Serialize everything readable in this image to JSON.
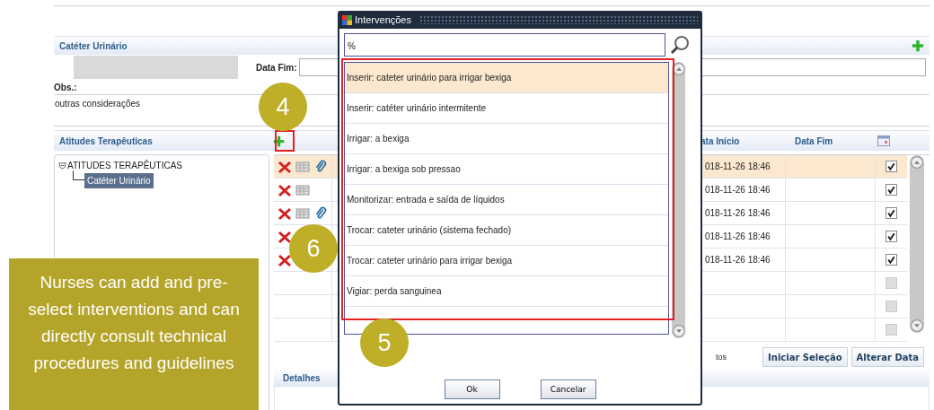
{
  "catheter": {
    "title": "Catéter Urinário",
    "date_end_label": "Data Fim:",
    "obs_label": "Obs.:",
    "obs_value": "outras considerações"
  },
  "therapeutic": {
    "title": "Atitudes Terapêuticas",
    "tree": [
      {
        "label": "ATITUDES TERAPÊUTICAS",
        "expanded": true,
        "children": [
          {
            "label": "Catéter Urinário",
            "selected": true
          }
        ]
      }
    ],
    "columns": [
      "ata Início",
      "Data Fim"
    ],
    "rows": [
      {
        "kind": "entry",
        "selected": true,
        "grid": true,
        "attachment": true,
        "start": "018-11-26 18:46",
        "checked": true
      },
      {
        "kind": "entry",
        "selected": false,
        "grid": true,
        "attachment": false,
        "start": "018-11-26 18:46",
        "checked": true
      },
      {
        "kind": "entry",
        "selected": false,
        "grid": true,
        "attachment": true,
        "start": "018-11-26 18:46",
        "checked": true
      },
      {
        "kind": "entry",
        "selected": false,
        "grid": false,
        "attachment": false,
        "start": "018-11-26 18:46",
        "checked": true
      },
      {
        "kind": "entry",
        "selected": false,
        "grid": false,
        "attachment": false,
        "start": "018-11-26 18:46",
        "checked": true
      },
      {
        "kind": "empty",
        "selected": false,
        "checked": false
      },
      {
        "kind": "empty",
        "selected": false,
        "checked": false
      },
      {
        "kind": "empty",
        "selected": false,
        "checked": false
      }
    ],
    "footer_text": "tos",
    "buttons": [
      "Iniciar Seleção",
      "Alterar Data"
    ],
    "details_title": "Detalhes"
  },
  "dialog": {
    "title": "Intervenções",
    "search_value": "%",
    "items": [
      {
        "label": "Inserir: cateter urinário para irrigar bexiga",
        "selected": true
      },
      {
        "label": "Inserir: catéter urinário intermitente",
        "selected": false
      },
      {
        "label": "Irrigar: a bexiga",
        "selected": false
      },
      {
        "label": "Irrigar: a bexiga sob pressao",
        "selected": false
      },
      {
        "label": "Monitorizar: entrada e saída de líquidos",
        "selected": false
      },
      {
        "label": "Trocar: cateter urinário (sistema fechado)",
        "selected": false
      },
      {
        "label": "Trocar: cateter urinário para irrigar bexiga",
        "selected": false
      },
      {
        "label": "Vigiar: perda sanguinea",
        "selected": false
      }
    ],
    "buttons": [
      "Ok",
      "Cancelar"
    ]
  },
  "callouts": [
    "4",
    "6",
    "5"
  ],
  "note": "Nurses can add and pre-select interventions and can directly consult technical procedures and guidelines"
}
